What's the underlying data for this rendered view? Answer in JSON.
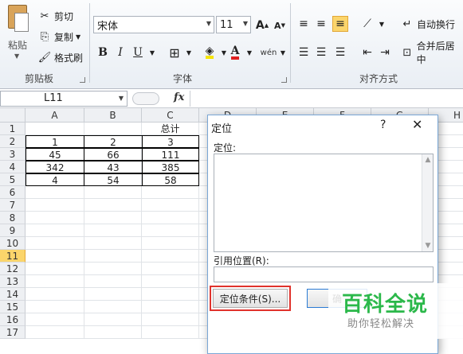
{
  "ribbon": {
    "clipboard": {
      "paste_label": "粘贴",
      "cut_label": "剪切",
      "copy_label": "复制",
      "format_painter_label": "格式刷",
      "group_label": "剪贴板"
    },
    "font": {
      "font_name": "宋体",
      "font_size": "11",
      "grow_label": "A",
      "shrink_label": "A",
      "bold": "B",
      "italic": "I",
      "underline": "U",
      "font_color_glyph": "A",
      "phonetic_glyph": "wén",
      "group_label": "字体"
    },
    "alignment": {
      "wrap_text_label": "自动换行",
      "merge_center_label": "合并后居中",
      "group_label": "对齐方式"
    }
  },
  "formula_bar": {
    "name_box": "L11",
    "fx_label": "fx"
  },
  "sheet": {
    "columns": [
      "A",
      "B",
      "C",
      "D",
      "E",
      "F",
      "G",
      "H"
    ],
    "rows": [
      "1",
      "2",
      "3",
      "4",
      "5",
      "6",
      "7",
      "8",
      "9",
      "10",
      "11",
      "12",
      "13",
      "14",
      "15",
      "16",
      "17"
    ],
    "selected_row": "11",
    "cells": {
      "C1": "总计",
      "A2": "1",
      "B2": "2",
      "C2": "3",
      "A3": "45",
      "B3": "66",
      "C3": "111",
      "A4": "342",
      "B4": "43",
      "C4": "385",
      "A5": "4",
      "B5": "54",
      "C5": "58"
    }
  },
  "dialog": {
    "title": "定位",
    "help": "?",
    "close": "✕",
    "goto_label": "定位:",
    "reference_label": "引用位置(R):",
    "special_button": "定位条件(S)...",
    "ok_button": "确"
  },
  "watermark": {
    "title": "百科全说",
    "subtitle": "助你轻松解决"
  },
  "colors": {
    "selected_row_header": "#fbd56b",
    "highlight_outline": "#e0322c",
    "watermark_green": "#2bb84a"
  }
}
